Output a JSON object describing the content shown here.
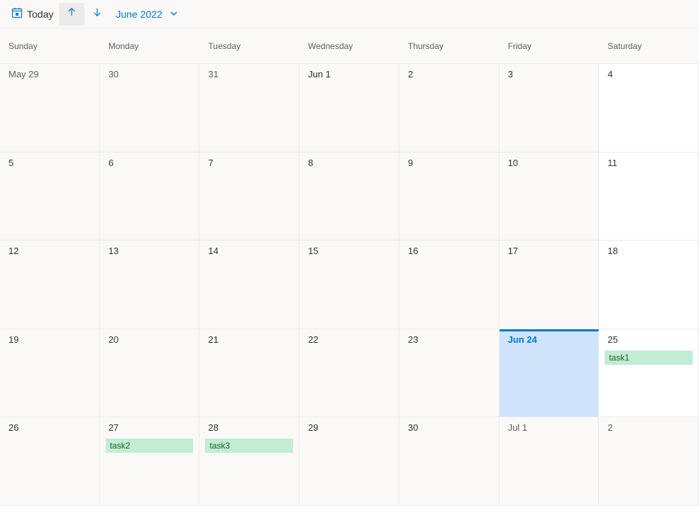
{
  "toolbar": {
    "today_label": "Today",
    "month_label": "June 2022"
  },
  "weekdays": [
    "Sunday",
    "Monday",
    "Tuesday",
    "Wednesday",
    "Thursday",
    "Friday",
    "Saturday"
  ],
  "weeks": [
    [
      {
        "label": "May 29",
        "other": true
      },
      {
        "label": "30",
        "other": true
      },
      {
        "label": "31",
        "other": true
      },
      {
        "label": "Jun 1"
      },
      {
        "label": "2"
      },
      {
        "label": "3"
      },
      {
        "label": "4"
      }
    ],
    [
      {
        "label": "5"
      },
      {
        "label": "6"
      },
      {
        "label": "7"
      },
      {
        "label": "8"
      },
      {
        "label": "9"
      },
      {
        "label": "10"
      },
      {
        "label": "11"
      }
    ],
    [
      {
        "label": "12"
      },
      {
        "label": "13"
      },
      {
        "label": "14"
      },
      {
        "label": "15"
      },
      {
        "label": "16"
      },
      {
        "label": "17"
      },
      {
        "label": "18"
      }
    ],
    [
      {
        "label": "19"
      },
      {
        "label": "20"
      },
      {
        "label": "21"
      },
      {
        "label": "22"
      },
      {
        "label": "23"
      },
      {
        "label": "Jun 24",
        "today": true
      },
      {
        "label": "25",
        "events": [
          "task1"
        ]
      }
    ],
    [
      {
        "label": "26"
      },
      {
        "label": "27",
        "events": [
          "task2"
        ]
      },
      {
        "label": "28",
        "events": [
          "task3"
        ]
      },
      {
        "label": "29"
      },
      {
        "label": "30"
      },
      {
        "label": "Jul 1",
        "other": true
      },
      {
        "label": "2",
        "other": true
      }
    ]
  ]
}
